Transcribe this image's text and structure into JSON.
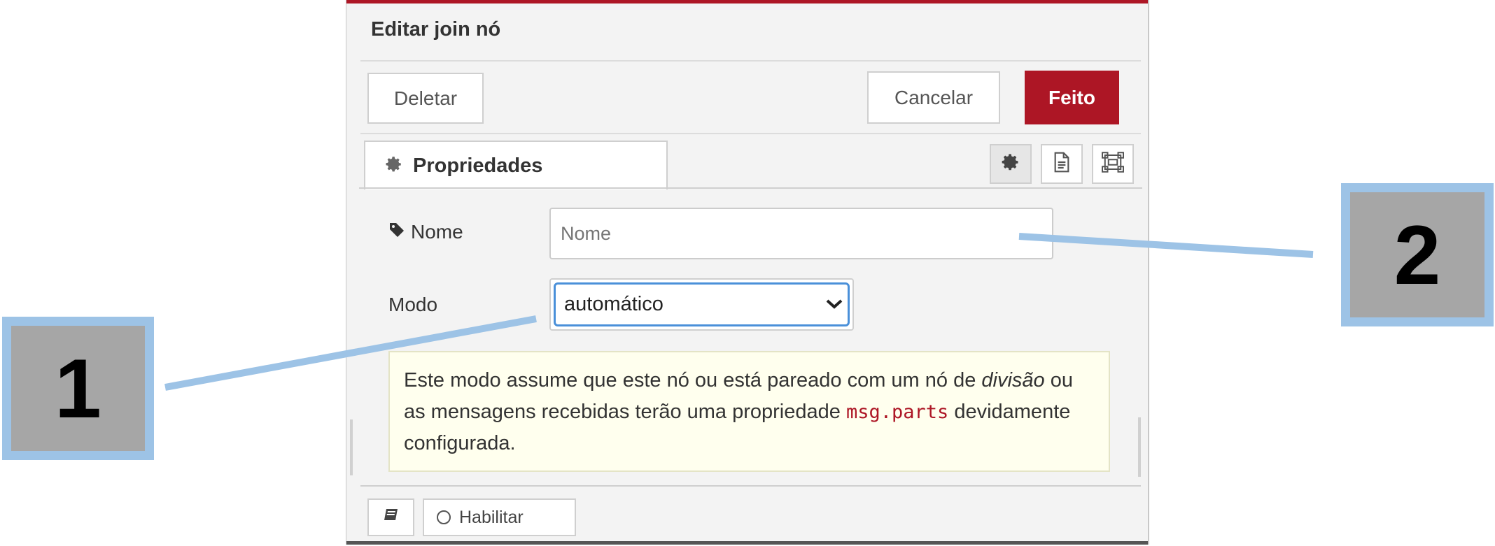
{
  "panel": {
    "title": "Editar join nó",
    "delete_label": "Deletar",
    "cancel_label": "Cancelar",
    "done_label": "Feito"
  },
  "tabs": {
    "properties_label": "Propriedades",
    "icons": [
      "gear-icon",
      "description-icon",
      "appearance-icon"
    ]
  },
  "form": {
    "name_label": "Nome",
    "name_placeholder": "Nome",
    "name_value": "",
    "mode_label": "Modo",
    "mode_value": "automático"
  },
  "info": {
    "text_1": "Este modo assume que este nó ou está pareado com um nó de ",
    "text_italic": "divisão",
    "text_2": " ou as mensagens recebidas terão uma propriedade ",
    "code": "msg.parts",
    "text_3": " devidamente configurada."
  },
  "footer": {
    "enable_label": "Habilitar"
  },
  "callouts": {
    "one": "1",
    "two": "2"
  },
  "colors": {
    "accent": "#ad1625",
    "callout_border": "#9dc3e6",
    "callout_fill": "#a6a6a6",
    "info_bg": "#ffffee"
  }
}
